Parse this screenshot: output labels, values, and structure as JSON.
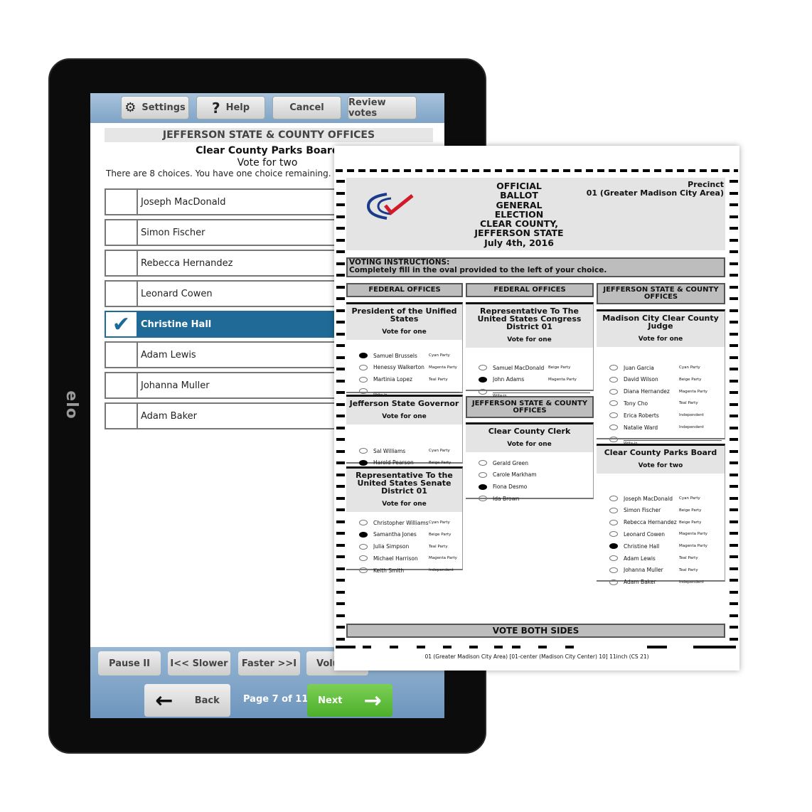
{
  "device": {
    "brand": "elo"
  },
  "toolbar": {
    "settings": "Settings",
    "help": "Help",
    "cancel": "Cancel",
    "review": "Review votes"
  },
  "screen": {
    "section_title": "JEFFERSON STATE & COUNTY OFFICES",
    "contest_title": "Clear County Parks Board",
    "vote_for": "Vote for two",
    "instructions": "There are 8 choices. You have one choice remaining.",
    "candidates": [
      {
        "name": "Joseph MacDonald",
        "selected": false
      },
      {
        "name": "Simon Fischer",
        "selected": false
      },
      {
        "name": "Rebecca Hernandez",
        "selected": false
      },
      {
        "name": "Leonard Cowen",
        "selected": false
      },
      {
        "name": "Christine Hall",
        "selected": true
      },
      {
        "name": "Adam Lewis",
        "selected": false
      },
      {
        "name": "Johanna Muller",
        "selected": false
      },
      {
        "name": "Adam Baker",
        "selected": false
      }
    ],
    "audio": {
      "pause": "Pause II",
      "slower": "I<< Slower",
      "faster": "Faster >>I",
      "volume": "Volu"
    },
    "nav": {
      "back": "Back",
      "page": "Page 7 of 11",
      "next": "Next"
    },
    "colors": {
      "selected": "#1f6a97",
      "next": "#4caf2a"
    }
  },
  "ballot": {
    "title": "OFFICIAL\nBALLOT\nGENERAL\nELECTION\nCLEAR COUNTY,\nJEFFERSON STATE\nJuly 4th, 2016",
    "precinct_label": "Precinct",
    "precinct": "01 (Greater Madison City Area)",
    "instructions_title": "VOTING INSTRUCTIONS:",
    "instructions": "Completely fill in the oval provided to the left of your choice.",
    "headers": {
      "federal": "FEDERAL OFFICES",
      "state": "JEFFERSON STATE & COUNTY OFFICES"
    },
    "write_in": "Write-in",
    "vote_both_sides": "VOTE BOTH SIDES",
    "footer": "01 (Greater Madison City Area) [01-center (Madison City Center) 10] 11inch (CS 21)",
    "contests": [
      {
        "title": "President of the Unified States",
        "vote_for": "Vote for one",
        "write_in": true,
        "candidates": [
          {
            "name": "Samuel Brussels",
            "party": "Cyan Party",
            "filled": true
          },
          {
            "name": "Henessy Walkerton",
            "party": "Magenta Party",
            "filled": false
          },
          {
            "name": "Martinia Lopez",
            "party": "Teal Party",
            "filled": false
          }
        ]
      },
      {
        "title": "Jefferson State Governor",
        "vote_for": "Vote for one",
        "write_in": false,
        "candidates": [
          {
            "name": "Sal Williams",
            "party": "Cyan Party",
            "filled": false
          },
          {
            "name": "Harold Pearson",
            "party": "Beige Party",
            "filled": true
          }
        ]
      },
      {
        "title": "Representative To the United States Senate District 01",
        "vote_for": "Vote for one",
        "write_in": false,
        "candidates": [
          {
            "name": "Christopher Williams",
            "party": "Cyan Party",
            "filled": false
          },
          {
            "name": "Samantha Jones",
            "party": "Beige Party",
            "filled": true
          },
          {
            "name": "Julia Simpson",
            "party": "Teal Party",
            "filled": false
          },
          {
            "name": "Michael Harrison",
            "party": "Magenta Party",
            "filled": false
          },
          {
            "name": "Keith Smith",
            "party": "Independent",
            "filled": false
          }
        ]
      },
      {
        "title": "Representative To The United States Congress District 01",
        "vote_for": "Vote for one",
        "write_in": true,
        "candidates": [
          {
            "name": "Samuel MacDonald",
            "party": "Beige Party",
            "filled": false
          },
          {
            "name": "John Adams",
            "party": "Magenta Party",
            "filled": true
          }
        ]
      },
      {
        "title": "Clear County Clerk",
        "vote_for": "Vote for one",
        "write_in": false,
        "candidates": [
          {
            "name": "Gerald Green",
            "party": "",
            "filled": false
          },
          {
            "name": "Carole Markham",
            "party": "",
            "filled": false
          },
          {
            "name": "Fiona Desmo",
            "party": "",
            "filled": true
          },
          {
            "name": "Ida Brown",
            "party": "",
            "filled": false
          }
        ]
      },
      {
        "title": "Madison City Clear County Judge",
        "vote_for": "Vote for one",
        "write_in": true,
        "candidates": [
          {
            "name": "Juan Garcia",
            "party": "Cyan Party",
            "filled": false
          },
          {
            "name": "David Wilson",
            "party": "Beige Party",
            "filled": false
          },
          {
            "name": "Diana Hernandez",
            "party": "Magenta Party",
            "filled": false
          },
          {
            "name": "Tony Cho",
            "party": "Teal Party",
            "filled": false
          },
          {
            "name": "Erica Roberts",
            "party": "Independent",
            "filled": false
          },
          {
            "name": "Natalie Ward",
            "party": "Independent",
            "filled": false
          }
        ]
      },
      {
        "title": "Clear County Parks Board",
        "vote_for": "Vote for two",
        "write_in": false,
        "candidates": [
          {
            "name": "Joseph MacDonald",
            "party": "Cyan Party",
            "filled": false
          },
          {
            "name": "Simon Fischer",
            "party": "Beige Party",
            "filled": false
          },
          {
            "name": "Rebecca Hernandez",
            "party": "Beige Party",
            "filled": false
          },
          {
            "name": "Leonard Cowen",
            "party": "Magenta Party",
            "filled": false
          },
          {
            "name": "Christine Hall",
            "party": "Magenta Party",
            "filled": true
          },
          {
            "name": "Adam Lewis",
            "party": "Teal Party",
            "filled": false
          },
          {
            "name": "Johanna Muller",
            "party": "Teal Party",
            "filled": false
          },
          {
            "name": "Adam Baker",
            "party": "Independent",
            "filled": false
          }
        ]
      }
    ]
  }
}
